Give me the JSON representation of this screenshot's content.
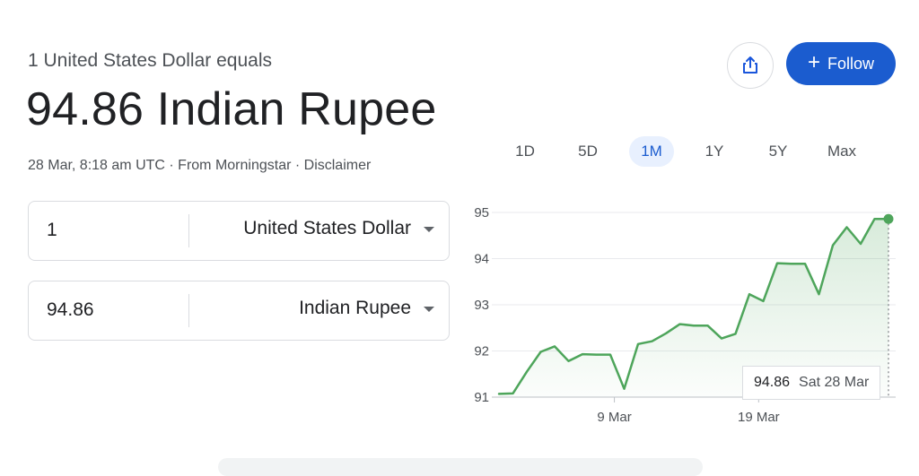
{
  "header": {
    "subtitle": "1 United States Dollar equals",
    "converted_value": "94.86 Indian Rupee",
    "timestamp": "28 Mar, 8:18 am UTC",
    "separator": " · ",
    "source": "From Morningstar",
    "disclaimer": "Disclaimer"
  },
  "actions": {
    "share_icon": "share-icon",
    "follow_label": "Follow",
    "follow_icon": "+"
  },
  "converter": {
    "from": {
      "amount": "1",
      "currency": "United States Dollar"
    },
    "to": {
      "amount": "94.86",
      "currency": "Indian Rupee"
    }
  },
  "ranges": {
    "tabs": [
      "1D",
      "5D",
      "1M",
      "1Y",
      "5Y",
      "Max"
    ],
    "active": "1M"
  },
  "tooltip": {
    "value": "94.86",
    "date": "Sat 28 Mar"
  },
  "colors": {
    "line": "#4ea55b",
    "accent": "#1b5ccf",
    "grid": "#e8eaed"
  },
  "chart_data": {
    "type": "area",
    "ylim": [
      91,
      95
    ],
    "y_ticks": [
      "95",
      "94",
      "93",
      "92",
      "91"
    ],
    "x_ticks": [
      {
        "label": "9 Mar",
        "day": 9
      },
      {
        "label": "19 Mar",
        "day": 19
      }
    ],
    "x_range": [
      1,
      28
    ],
    "values": [
      91.07,
      91.08,
      91.55,
      91.98,
      92.1,
      91.78,
      91.93,
      91.92,
      91.92,
      91.18,
      92.15,
      92.21,
      92.38,
      92.58,
      92.55,
      92.55,
      92.27,
      92.37,
      93.23,
      93.08,
      93.9,
      93.89,
      93.89,
      93.23,
      94.29,
      94.68,
      94.32,
      94.86,
      94.86
    ]
  }
}
